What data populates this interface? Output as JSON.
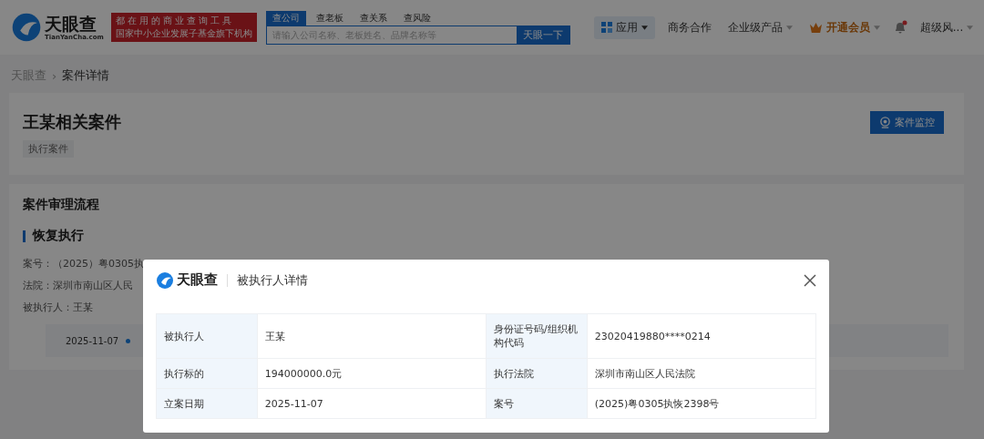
{
  "header": {
    "logo": {
      "name": "天眼查",
      "domain": "TianYanCha.com"
    },
    "slogan": [
      "都在用的商业查询工具",
      "国家中小企业发展子基金旗下机构"
    ],
    "search": {
      "tabs": [
        {
          "label": "查公司",
          "selected": true
        },
        {
          "label": "查老板",
          "selected": false
        },
        {
          "label": "查关系",
          "selected": false
        },
        {
          "label": "查风险",
          "selected": false
        }
      ],
      "placeholder": "请输入公司名称、老板姓名、品牌名称等",
      "button": "天眼一下"
    },
    "nav": [
      {
        "label": "应用",
        "kind": "apps",
        "dropdown": true,
        "selected": true
      },
      {
        "label": "商务合作",
        "kind": "plain",
        "dropdown": false,
        "selected": false
      },
      {
        "label": "企业级产品",
        "kind": "plain",
        "dropdown": true,
        "selected": false
      },
      {
        "label": "开通会员",
        "kind": "vip",
        "dropdown": true,
        "selected": false
      },
      {
        "kind": "bell",
        "unread": true
      },
      {
        "label": "超级风...",
        "kind": "plain",
        "dropdown": true,
        "selected": false
      }
    ]
  },
  "breadcrumb": [
    "天眼查",
    "›",
    "案件详情"
  ],
  "case": {
    "title": "王某相关案件",
    "tag": "执行案件",
    "button": "案件监控"
  },
  "process": {
    "title": "案件审理流程",
    "stage": "恢复执行",
    "fields": [
      {
        "label": "案号：",
        "value": "（2025）粤0305执"
      },
      {
        "label": "法院：",
        "value": "深圳市南山区人民"
      },
      {
        "label": "被执行人：",
        "value": "王某"
      }
    ],
    "timeline_date": "2025-11-07"
  },
  "dialog": {
    "logo": "天眼查",
    "title": "被执行人详情",
    "rows": [
      [
        {
          "label": "被执行人",
          "value": "王某"
        },
        {
          "label": "身份证号码/组织机构代码",
          "value": "23020419880****0214"
        }
      ],
      [
        {
          "label": "执行标的",
          "value": "194000000.0元"
        },
        {
          "label": "执行法院",
          "value": "深圳市南山区人民法院"
        }
      ],
      [
        {
          "label": "立案日期",
          "value": "2025-11-07"
        },
        {
          "label": "案号",
          "value": "(2025)粤0305执恢2398号"
        }
      ]
    ]
  }
}
